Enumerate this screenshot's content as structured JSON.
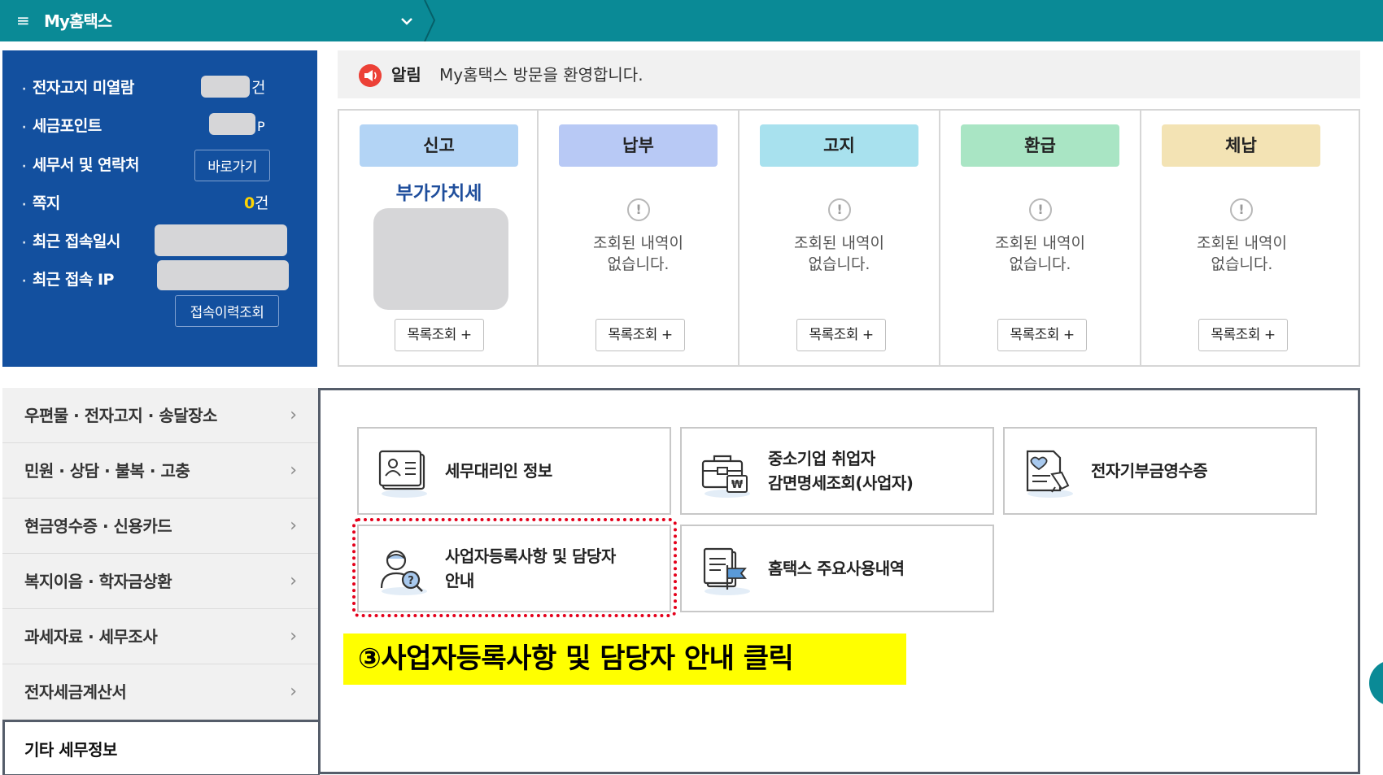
{
  "topbar": {
    "title": "My홈택스"
  },
  "info_panel": {
    "rows": [
      {
        "label": "전자고지 미열람",
        "unit": "건"
      },
      {
        "label": "세금포인트",
        "unit": "P"
      },
      {
        "label": "세무서 및 연락처",
        "button": "바로가기"
      },
      {
        "label": "쪽지",
        "count": "0",
        "unit": "건"
      },
      {
        "label": "최근 접속일시"
      },
      {
        "label": "최근 접속 IP"
      }
    ],
    "history_button": "접속이력조회"
  },
  "notice": {
    "label": "알림",
    "message": "My홈택스 방문을 환영합니다."
  },
  "status": {
    "columns": [
      {
        "title": "신고",
        "color": "#b3d4f5",
        "item": "부가가치세",
        "button": "목록조회 +"
      },
      {
        "title": "납부",
        "color": "#b8c9f5",
        "empty": "조회된 내역이\n없습니다.",
        "button": "목록조회 +"
      },
      {
        "title": "고지",
        "color": "#a8e1ee",
        "empty": "조회된 내역이\n없습니다.",
        "button": "목록조회 +"
      },
      {
        "title": "환급",
        "color": "#a9e5c4",
        "empty": "조회된 내역이\n없습니다.",
        "button": "목록조회 +"
      },
      {
        "title": "체납",
        "color": "#f3e3b4",
        "empty": "조회된 내역이\n없습니다.",
        "button": "목록조회 +"
      }
    ]
  },
  "side_menu": {
    "items": [
      {
        "label": "우편물 · 전자고지 · 송달장소"
      },
      {
        "label": "민원 · 상담 · 불복 · 고충"
      },
      {
        "label": "현금영수증 · 신용카드"
      },
      {
        "label": "복지이음 · 학자금상환"
      },
      {
        "label": "과세자료 · 세무조사"
      },
      {
        "label": "전자세금계산서"
      },
      {
        "label": "기타 세무정보"
      }
    ]
  },
  "cards": [
    {
      "label": "세무대리인 정보",
      "icon": "id-card-icon"
    },
    {
      "label": "중소기업 취업자\n감면명세조회(사업자)",
      "icon": "briefcase-won-icon"
    },
    {
      "label": "전자기부금영수증",
      "icon": "donation-receipt-icon"
    },
    {
      "label": "사업자등록사항 및 담당자\n안내",
      "icon": "person-question-icon"
    },
    {
      "label": "홈택스 주요사용내역",
      "icon": "document-flag-icon"
    }
  ],
  "callout": {
    "text": "③사업자등록사항 및 담당자 안내 클릭"
  },
  "colors": {
    "brand_teal": "#0a8a96",
    "panel_blue": "#13509f",
    "highlight_red": "#e4001b",
    "callout_yellow": "#ffff00"
  }
}
